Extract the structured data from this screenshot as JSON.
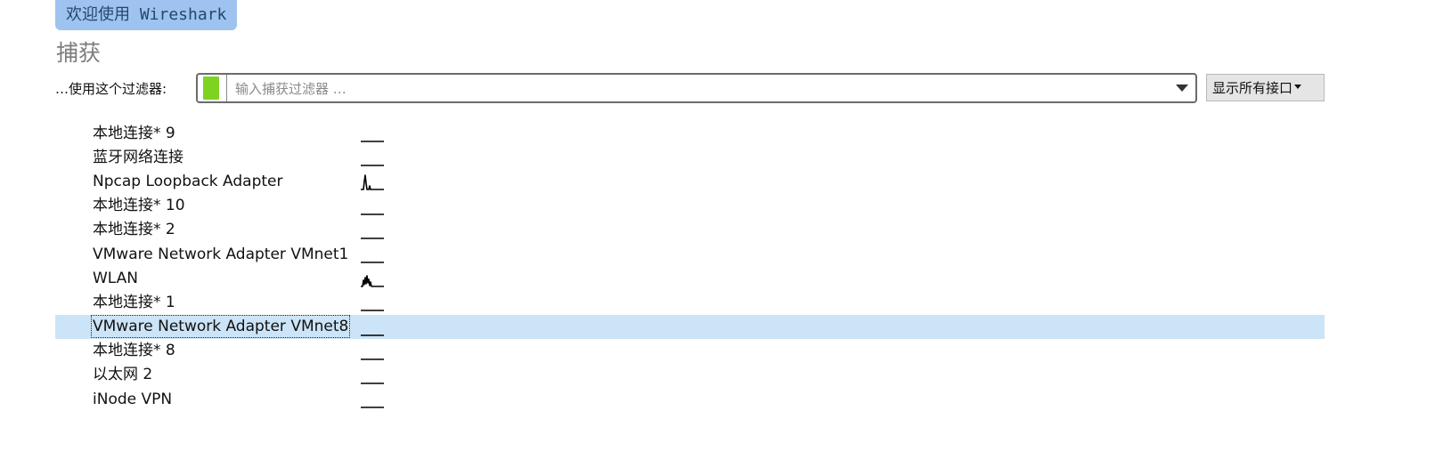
{
  "welcome": {
    "text": "欢迎使用 Wireshark"
  },
  "capture": {
    "title": "捕获",
    "filter_label": "…使用这个过滤器:",
    "filter_placeholder": "输入捕获过滤器 …",
    "filter_value": "",
    "interfaces_button": "显示所有接口"
  },
  "interfaces": [
    {
      "name": "本地连接* 9",
      "activity": "flat"
    },
    {
      "name": "蓝牙网络连接",
      "activity": "flat"
    },
    {
      "name": "Npcap Loopback Adapter",
      "activity": "spike"
    },
    {
      "name": "本地连接* 10",
      "activity": "flat"
    },
    {
      "name": "本地连接* 2",
      "activity": "flat"
    },
    {
      "name": "VMware Network Adapter VMnet1",
      "activity": "flat"
    },
    {
      "name": "WLAN",
      "activity": "busy"
    },
    {
      "name": "本地连接* 1",
      "activity": "flat"
    },
    {
      "name": "VMware Network Adapter VMnet8",
      "activity": "flat",
      "selected": true
    },
    {
      "name": "本地连接* 8",
      "activity": "flat"
    },
    {
      "name": "以太网 2",
      "activity": "flat"
    },
    {
      "name": "iNode VPN",
      "activity": "flat"
    }
  ],
  "colors": {
    "banner_bg": "#9ec3f0",
    "selection_bg": "#cce4f7",
    "bookmark": "#7ed321"
  }
}
